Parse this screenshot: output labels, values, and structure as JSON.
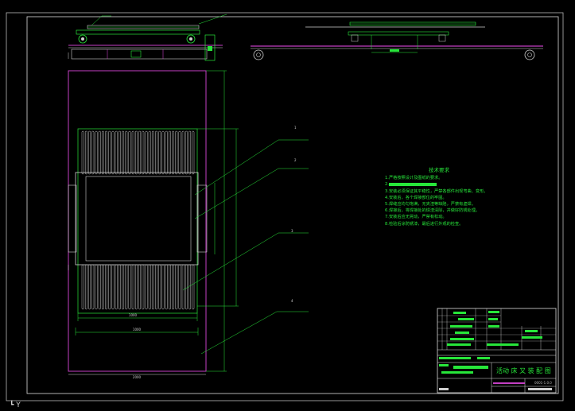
{
  "drawing": {
    "title": "活动 床 又 装 配 图",
    "code": "0001-1.0.0",
    "axis_indicator": "Y",
    "dimensions": {
      "inner_width": "1000",
      "outer_width": "1000",
      "overall_width": "2000"
    },
    "balloons": [
      "1",
      "2",
      "3",
      "4"
    ]
  },
  "technical_notes": {
    "heading": "技术要求",
    "lines": [
      "1.严格按照设计及图纸的要求。",
      "2.",
      "3.安装必须保证其平稳性，严禁各部件出现弯曲、变形。",
      "4.安装后，各个焊接部位的牢固。",
      "5.焊缝应均匀饱满，无夹渣等缺陷，严禁有虚焊。",
      "6.焊接后，将焊接处的焊渣清除，并做好防锈处理。",
      "7.安装后应无晃动，严禁有松动。",
      "8.检验后涂防锈漆，最后进行外观的检查。"
    ]
  },
  "colors": {
    "frame": "#c43fc4",
    "line": "#27e63a",
    "dim": "#d0d0d0",
    "background": "#000000"
  }
}
